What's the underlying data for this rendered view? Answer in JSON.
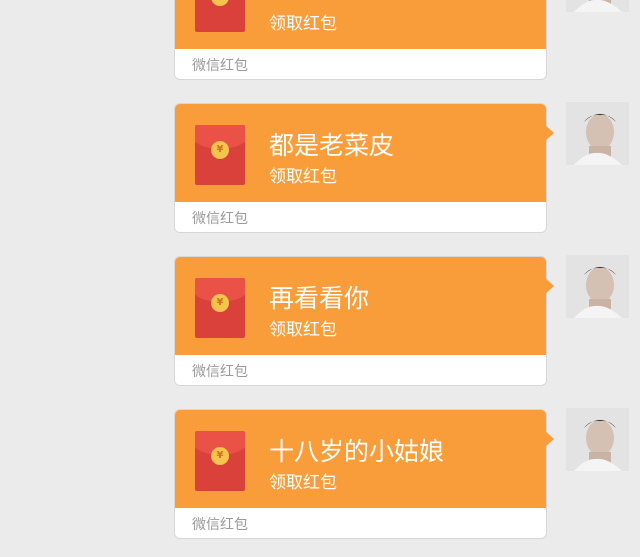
{
  "messages": [
    {
      "title": "",
      "action": "领取红包",
      "footer": "微信红包",
      "coin": "¥"
    },
    {
      "title": "都是老菜皮",
      "action": "领取红包",
      "footer": "微信红包",
      "coin": "¥"
    },
    {
      "title": "再看看你",
      "action": "领取红包",
      "footer": "微信红包",
      "coin": "¥"
    },
    {
      "title": "十八岁的小姑娘",
      "action": "领取红包",
      "footer": "微信红包",
      "coin": "¥"
    }
  ],
  "colors": {
    "background": "#ebebeb",
    "card": "#f99d3b",
    "envelope": "#d9413a",
    "coin": "#f4c44c"
  }
}
